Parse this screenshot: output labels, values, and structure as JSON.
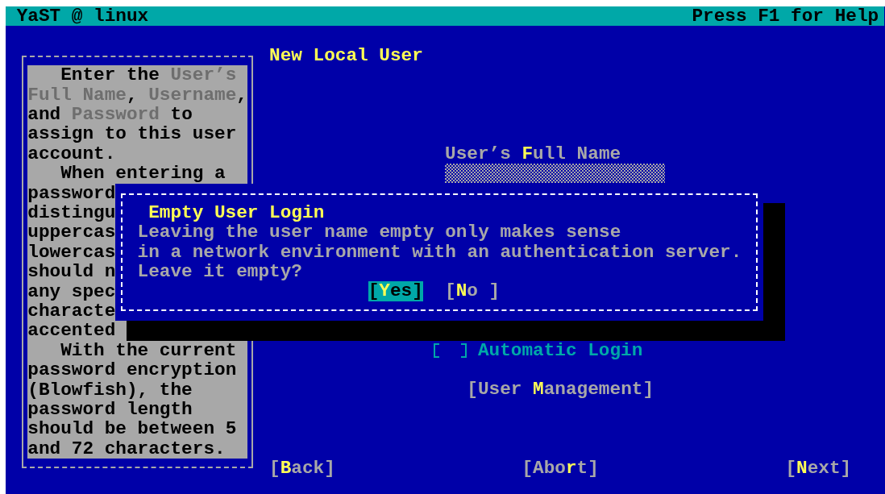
{
  "title_bar": {
    "title": "YaST @ linux",
    "help_hint": "Press F1 for Help"
  },
  "help": {
    "lines": [
      {
        "text": "Enter the *User’s*",
        "indent": true
      },
      {
        "text": "*Full Name*, *Username*,",
        "indent": false
      },
      {
        "text": "and *Password* to",
        "indent": false
      },
      {
        "text": "assign to this user",
        "indent": false
      },
      {
        "text": "account.",
        "indent": false
      },
      {
        "text": "When entering a",
        "indent": true
      },
      {
        "text": "password",
        "indent": false
      },
      {
        "text": "distingu",
        "indent": false
      },
      {
        "text": "uppercas",
        "indent": false
      },
      {
        "text": "lowercas",
        "indent": false
      },
      {
        "text": "should n",
        "indent": false
      },
      {
        "text": "any spec",
        "indent": false
      },
      {
        "text": "characte",
        "indent": false
      },
      {
        "text": "accented",
        "indent": false
      },
      {
        "text": "With the current",
        "indent": true
      },
      {
        "text": "password encryption",
        "indent": false
      },
      {
        "text": "(Blowfish), the",
        "indent": false
      },
      {
        "text": "password length",
        "indent": false
      },
      {
        "text": "should be between 5",
        "indent": false
      },
      {
        "text": "and 72 characters.",
        "indent": false
      }
    ]
  },
  "heading": "New Local User",
  "full_name": {
    "label": "User’s **F**ull Name"
  },
  "automatic_login": {
    "label": "Automatic Login",
    "checked": false
  },
  "user_management_button": "[User **M**anagement]",
  "buttons": [
    {
      "label": "[**B**ack]"
    },
    {
      "label": "[Abo**r**t]"
    },
    {
      "label": "[**N**ext]"
    }
  ],
  "dialog": {
    "title": "Empty User Login",
    "message": [
      "Leaving the user name empty only makes sense",
      "in a network environment with an authentication server.",
      "Leave it empty?"
    ],
    "buttons": [
      {
        "label": "[**Y**es]",
        "selected": true
      },
      {
        "label": "[**N**o ]",
        "selected": false
      }
    ]
  }
}
